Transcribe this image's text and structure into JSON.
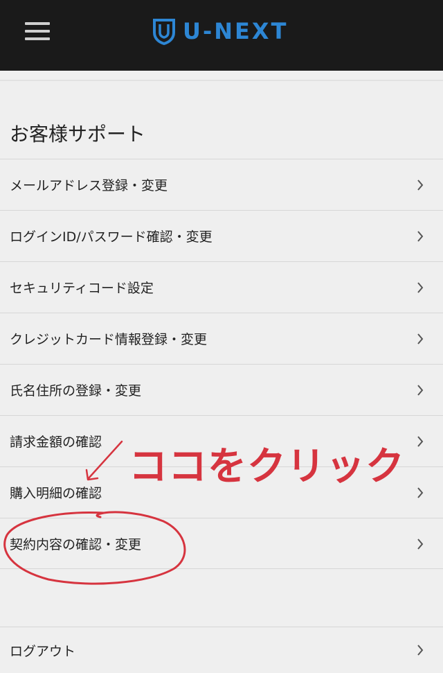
{
  "header": {
    "menu_icon": "hamburger-icon",
    "logo_text": "U-NEXT",
    "logo_icon": "shield-icon",
    "logo_color": "#2d86d4",
    "background": "#1a1a1a"
  },
  "section": {
    "title": "お客様サポート"
  },
  "menu": {
    "items": [
      {
        "label": "メールアドレス登録・変更"
      },
      {
        "label": "ログインID/パスワード確認・変更"
      },
      {
        "label": "セキュリティコード設定"
      },
      {
        "label": "クレジットカード情報登録・変更"
      },
      {
        "label": "氏名住所の登録・変更"
      },
      {
        "label": "請求金額の確認"
      },
      {
        "label": "購入明細の確認"
      },
      {
        "label": "契約内容の確認・変更"
      }
    ],
    "logout_label": "ログアウト",
    "chevron_icon": "chevron-right-icon"
  },
  "annotation": {
    "text": "ココをクリック",
    "color": "#d6343f"
  }
}
